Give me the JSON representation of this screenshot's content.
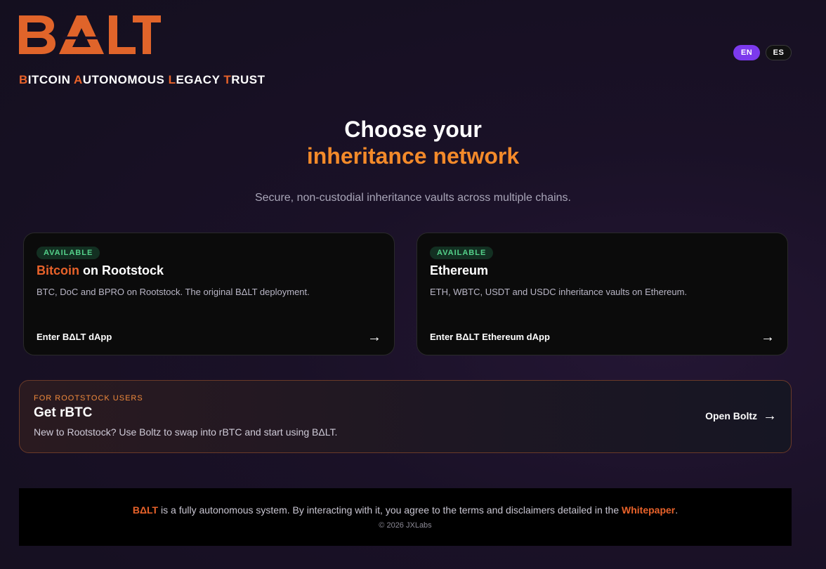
{
  "brand": {
    "logo": "BΔLT",
    "logo_color": "#e0642a",
    "tagline": [
      {
        "initial": "B",
        "rest": "ITCOIN "
      },
      {
        "initial": "A",
        "rest": "UTONOMOUS "
      },
      {
        "initial": "L",
        "rest": "EGACY "
      },
      {
        "initial": "T",
        "rest": "RUST"
      }
    ]
  },
  "language": {
    "options": [
      "EN",
      "ES"
    ],
    "selected": "EN"
  },
  "hero": {
    "title_line1": "Choose your",
    "title_line2": "inheritance network",
    "subtitle": "Secure, non-custodial inheritance vaults across multiple chains."
  },
  "networks": [
    {
      "badge": "AVAILABLE",
      "title_highlight": "Bitcoin",
      "title_rest": " on Rootstock",
      "description": "BTC, DoC and BPRO on Rootstock. The original BΔLT deployment.",
      "cta": "Enter BΔLT dApp",
      "arrow_icon": "→"
    },
    {
      "badge": "AVAILABLE",
      "title_highlight": "",
      "title_rest": "Ethereum",
      "description": "ETH, WBTC, USDT and USDC inheritance vaults on Ethereum.",
      "cta": "Enter BΔLT Ethereum dApp",
      "arrow_icon": "→"
    }
  ],
  "banner": {
    "kicker": "FOR ROOTSTOCK USERS",
    "title": "Get rBTC",
    "description": "New to Rootstock? Use Boltz to swap into rBTC and start using BΔLT.",
    "cta": "Open Boltz",
    "arrow_icon": "→"
  },
  "footer": {
    "brand": "BΔLT",
    "text": " is a fully autonomous system. By interacting with it, you agree to the terms and disclaimers detailed in the ",
    "link": "Whitepaper",
    "end": ".",
    "copyright": "© 2026 JXLabs"
  },
  "colors": {
    "accent_orange": "#e8622a",
    "accent_purple": "#7c3aed",
    "available_green": "#54d18a"
  }
}
